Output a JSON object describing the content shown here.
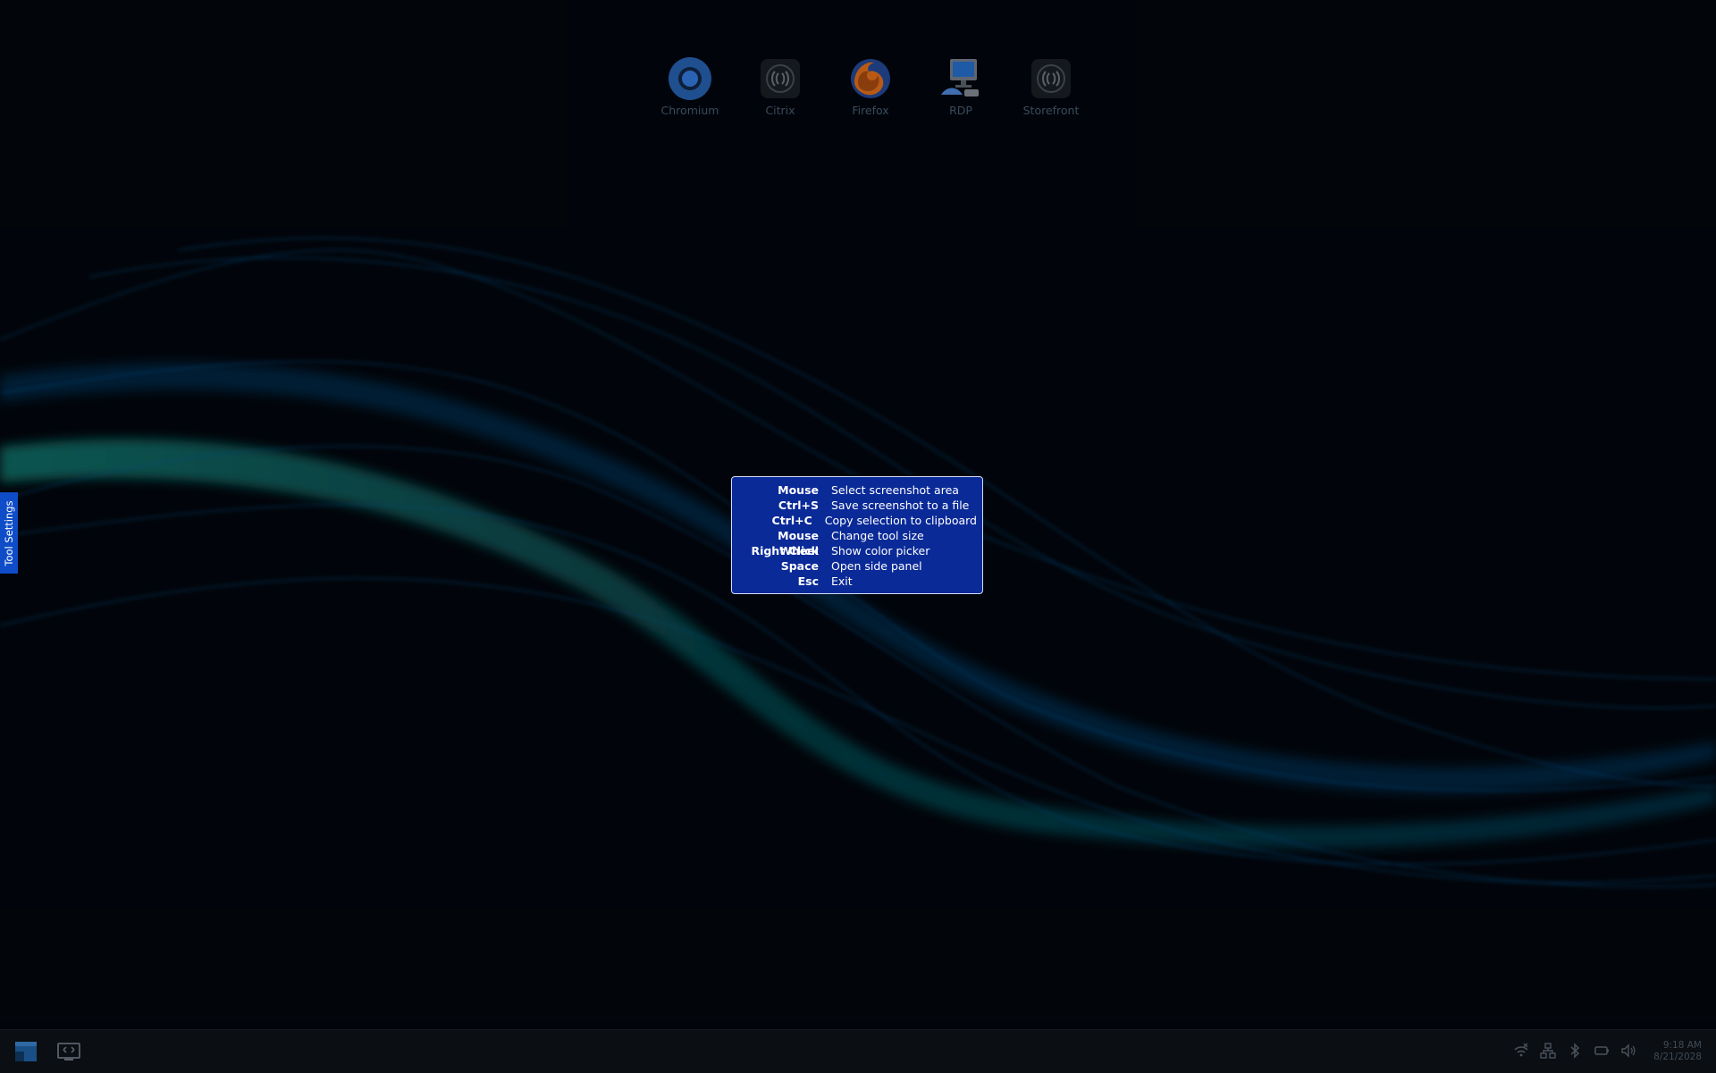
{
  "desktop": {
    "icons": [
      {
        "label": "Chromium",
        "icon": "chromium-icon"
      },
      {
        "label": "Citrix",
        "icon": "citrix-icon"
      },
      {
        "label": "Firefox",
        "icon": "firefox-icon"
      },
      {
        "label": "RDP",
        "icon": "rdp-icon"
      },
      {
        "label": "Storefront",
        "icon": "storefront-icon"
      }
    ]
  },
  "tool_settings_tab": "Tool Settings",
  "help": {
    "rows": [
      {
        "key": "Mouse",
        "desc": "Select screenshot area"
      },
      {
        "key": "Ctrl+S",
        "desc": "Save screenshot to a file"
      },
      {
        "key": "Ctrl+C",
        "desc": "Copy selection to clipboard"
      },
      {
        "key": "Mouse Wheel",
        "desc": "Change tool size"
      },
      {
        "key": "Right Click",
        "desc": "Show color picker"
      },
      {
        "key": "Space",
        "desc": "Open side panel"
      },
      {
        "key": "Esc",
        "desc": "Exit"
      }
    ]
  },
  "taskbar": {
    "start_icon": "app-menu-icon",
    "show_desktop_icon": "screenshot-icon",
    "tray": [
      "network-disconnected-icon",
      "network-icon",
      "bluetooth-icon",
      "battery-icon",
      "volume-icon"
    ],
    "time": "9:18 AM",
    "date": "8/21/2028"
  },
  "colors": {
    "help_bg": "#0a2a98",
    "help_border": "#d6dcf5",
    "tab_bg": "#0f4cc8",
    "wave_teal": "#0e6d6a",
    "wave_blue": "#0d3f73"
  }
}
